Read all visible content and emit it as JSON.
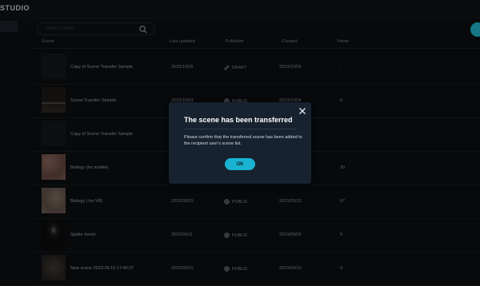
{
  "app": {
    "title": "STUDIO"
  },
  "search": {
    "placeholder": "Search scene",
    "value": ""
  },
  "table": {
    "headers": {
      "scene": "Scene",
      "last_updated": "Last updated",
      "publisher": "Publisher",
      "created": "Created",
      "views": "Views"
    },
    "rows": [
      {
        "title": "Copy of Scene Transfer Sample",
        "last_updated": "2023/10/05",
        "publish": "DRAFT",
        "publish_icon": "pencil-icon",
        "created": "2023/10/05",
        "views": "-",
        "thumb_color": "#131619"
      },
      {
        "title": "Scene Transfer Sample",
        "last_updated": "2023/10/04",
        "publish": "PUBLIC",
        "publish_icon": "globe-icon",
        "created": "2023/10/04",
        "views": "6",
        "thumb_color": "#2a2620"
      },
      {
        "title": "Copy of Scene Transfer Sample",
        "last_updated": "",
        "publish": "",
        "publish_icon": "",
        "created": "",
        "views": "-",
        "thumb_color": "#131619"
      },
      {
        "title": "Biology (for mobile)",
        "last_updated": "",
        "publish": "",
        "publish_icon": "",
        "created": "",
        "views": "30",
        "thumb_color": "#6a4d46"
      },
      {
        "title": "Biology ( for VR)",
        "last_updated": "2023/09/29",
        "publish": "PUBLIC",
        "publish_icon": "globe-icon",
        "created": "2023/01/13",
        "views": "67",
        "thumb_color": "#62524a"
      },
      {
        "title": "Spider forest",
        "last_updated": "2023/09/11",
        "publish": "PUBLIC",
        "publish_icon": "globe-icon",
        "created": "2023/09/06",
        "views": "9",
        "thumb_color": "#0c0c0d"
      },
      {
        "title": "New scene 2023.09.10 17:49:37",
        "last_updated": "2023/09/10",
        "publish": "PUBLIC",
        "publish_icon": "globe-icon",
        "created": "2023/09/10",
        "views": "4",
        "thumb_color": "#2c2824"
      }
    ]
  },
  "modal": {
    "title": "The scene has been transferred",
    "body": "Please confirm that the transferred scene has been added to the recipient user's scene list.",
    "ok_label": "OK",
    "close_icon": "close-icon"
  },
  "colors": {
    "accent": "#18b4d2",
    "modal_bg": "#162230",
    "page_bg": "#0b0d10"
  }
}
